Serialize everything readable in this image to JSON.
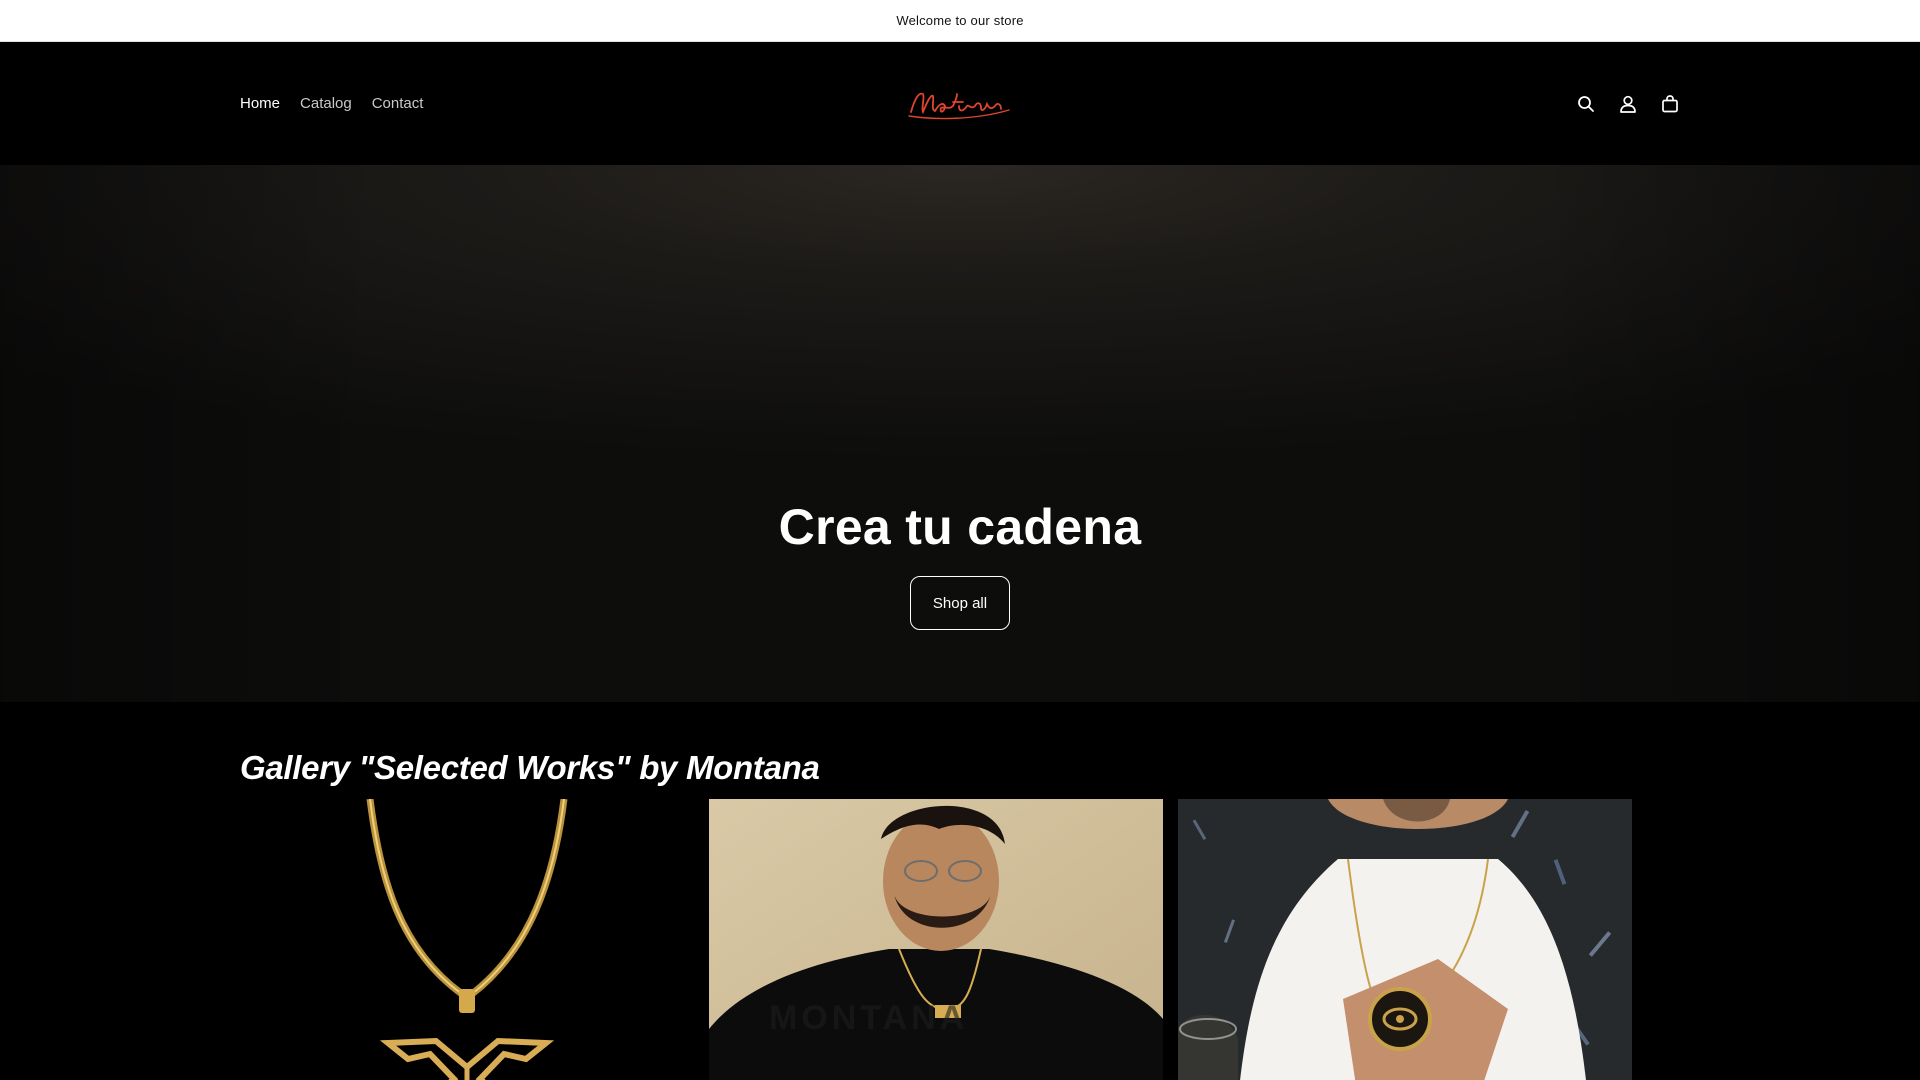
{
  "announcement": {
    "text": "Welcome to our store"
  },
  "header": {
    "nav": [
      {
        "label": "Home",
        "active": true
      },
      {
        "label": "Catalog",
        "active": false
      },
      {
        "label": "Contact",
        "active": false
      }
    ],
    "logo_text": "Montana",
    "icons": [
      "search-icon",
      "account-icon",
      "cart-icon"
    ]
  },
  "hero": {
    "title": "Crea tu cadena",
    "button_label": "Shop all"
  },
  "gallery": {
    "title": "Gallery \"Selected Works\" by Montana",
    "items": [
      "gold-pendant-necklace-image",
      "man-wearing-chain-image",
      "eye-pendant-chain-image"
    ]
  },
  "colors": {
    "logo": "#e0452e",
    "gold": "#c9a24a",
    "background": "#000000"
  }
}
